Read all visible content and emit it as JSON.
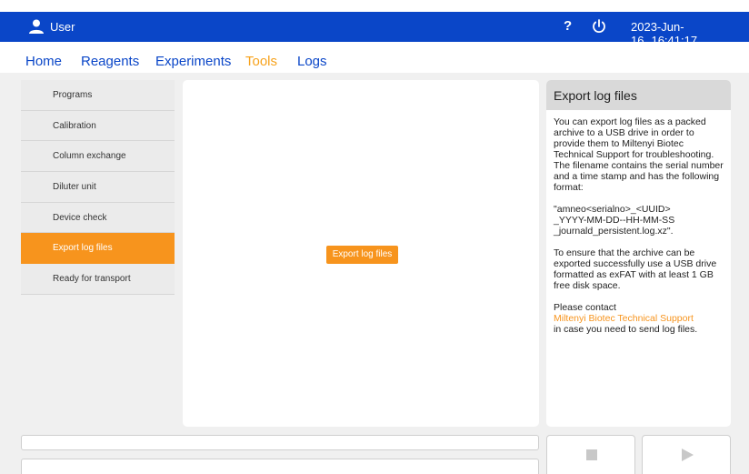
{
  "header": {
    "user_label": "User",
    "help_symbol": "?",
    "date": "2023-Jun-16",
    "time": "16:41:17",
    "icons": {
      "user": "user-icon",
      "help": "help-icon",
      "power": "power-icon"
    }
  },
  "nav": {
    "tabs": [
      {
        "label": "Home",
        "active": false
      },
      {
        "label": "Reagents",
        "active": false
      },
      {
        "label": "Experiments",
        "active": false
      },
      {
        "label": "Tools",
        "active": true
      },
      {
        "label": "Logs",
        "active": false
      }
    ]
  },
  "sidebar": {
    "items": [
      {
        "label": "Programs"
      },
      {
        "label": "Calibration"
      },
      {
        "label": "Column exchange"
      },
      {
        "label": "Diluter unit"
      },
      {
        "label": "Device check"
      },
      {
        "label": "Export log files",
        "active": true
      },
      {
        "label": "Ready for transport"
      }
    ]
  },
  "main": {
    "action_button": "Export log files"
  },
  "help": {
    "title": "Export log files",
    "p1": "You can export log files as a packed archive to a USB drive in order to provide them to Miltenyi Biotec Technical Support for troubleshooting. The filename contains the serial number and a time stamp and has the following format:",
    "p2_line1": "\"amneo<serialno>_<UUID>",
    "p2_line2": "_YYYY-MM-DD--HH-MM-SS",
    "p2_line3": "_journald_persistent.log.xz\".",
    "p3": "To ensure that the archive can be exported successfully use a USB drive formatted as exFAT with at least 1 GB free disk space.",
    "p4_prefix": "Please contact",
    "p4_link": "Miltenyi Biotec Technical Support",
    "p4_suffix": "in case you need to send log files."
  },
  "controls": {
    "stop_icon": "stop-icon",
    "play_icon": "play-icon"
  },
  "colors": {
    "header_blue": "#0a46c8",
    "accent_orange": "#f7941d",
    "tab_active": "#f7a21b"
  }
}
